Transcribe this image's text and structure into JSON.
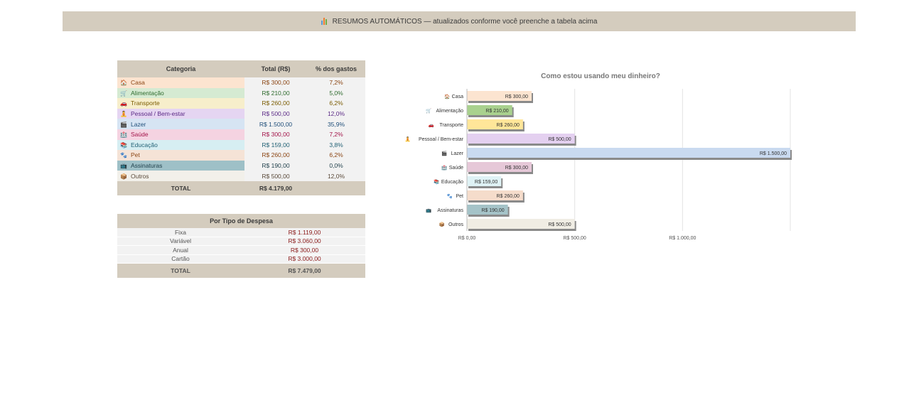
{
  "banner": {
    "icon": "bar-chart-icon",
    "text": "RESUMOS AUTOMÁTICOS — atualizados conforme você preenche a tabela acima"
  },
  "category_table": {
    "headers": [
      "Categoria",
      "Total (R$)",
      "% dos gastos"
    ],
    "rows": [
      {
        "icon": "house-icon",
        "glyph": "🏠",
        "name": "Casa",
        "total": "R$ 300,00",
        "pct": "7,2%",
        "bg": "#fce4d0",
        "color": "#8b4513"
      },
      {
        "icon": "shopping-cart-icon",
        "glyph": "🛒",
        "name": "Alimentação",
        "total": "R$ 210,00",
        "pct": "5,0%",
        "bg": "#d5ead2",
        "color": "#2e6b2e"
      },
      {
        "icon": "car-icon",
        "glyph": "🚗",
        "name": "Transporte",
        "total": "R$ 260,00",
        "pct": "6,2%",
        "bg": "#f7eecb",
        "color": "#7a5b00"
      },
      {
        "icon": "person-icon",
        "glyph": "🧘",
        "name": "Pessoal / Bem-estar",
        "total": "R$ 500,00",
        "pct": "12,0%",
        "bg": "#e5d5f2",
        "color": "#5b2a86"
      },
      {
        "icon": "film-icon",
        "glyph": "🎬",
        "name": "Lazer",
        "total": "R$ 1.500,00",
        "pct": "35,9%",
        "bg": "#d6e4f3",
        "color": "#1f4e79"
      },
      {
        "icon": "hospital-icon",
        "glyph": "🏥",
        "name": "Saúde",
        "total": "R$ 300,00",
        "pct": "7,2%",
        "bg": "#f5d3e1",
        "color": "#a3154a"
      },
      {
        "icon": "books-icon",
        "glyph": "📚",
        "name": "Educação",
        "total": "R$ 159,00",
        "pct": "3,8%",
        "bg": "#d6eef2",
        "color": "#1f5f73"
      },
      {
        "icon": "paw-icon",
        "glyph": "🐾",
        "name": "Pet",
        "total": "R$ 260,00",
        "pct": "6,2%",
        "bg": "#f5e3d6",
        "color": "#8b4513"
      },
      {
        "icon": "subscription-icon",
        "glyph": "📺",
        "name": "Assinaturas",
        "total": "R$ 190,00",
        "pct": "0,0%",
        "bg": "#9ec0c7",
        "color": "#1f3f4a"
      },
      {
        "icon": "box-icon",
        "glyph": "📦",
        "name": "Outros",
        "total": "R$ 500,00",
        "pct": "12,0%",
        "bg": "#f2f0ea",
        "color": "#5a4a3a"
      }
    ],
    "total_label": "TOTAL",
    "total_value": "R$ 4.179,00"
  },
  "type_table": {
    "header": "Por Tipo de Despesa",
    "rows": [
      {
        "name": "Fixa",
        "value": "R$ 1.119,00"
      },
      {
        "name": "Variável",
        "value": "R$ 3.060,00"
      },
      {
        "name": "Anual",
        "value": "R$ 300,00"
      },
      {
        "name": "Cartão",
        "value": "R$ 3.000,00"
      }
    ],
    "total_label": "TOTAL",
    "total_value": "R$ 7.479,00"
  },
  "chart_data": {
    "type": "bar",
    "orientation": "horizontal",
    "title": "Como estou usando meu dinheiro?",
    "categories": [
      "Casa",
      "Alimentação",
      "Transporte",
      "Pessoal / Bem-estar",
      "Lazer",
      "Saúde",
      "Educação",
      "Pet",
      "Assinaturas",
      "Outros"
    ],
    "values": [
      300,
      210,
      260,
      500,
      1500,
      300,
      159,
      260,
      190,
      500
    ],
    "value_labels": [
      "R$ 300,00",
      "R$ 210,00",
      "R$ 260,00",
      "R$ 500,00",
      "R$ 1.500,00",
      "R$ 300,00",
      "R$ 159,00",
      "R$ 260,00",
      "R$ 190,00",
      "R$ 500,00"
    ],
    "bar_colors": [
      "#fce4d0",
      "#a9d18e",
      "#ffe699",
      "#e4d0f0",
      "#c9daf0",
      "#e6c8d8",
      "#dff2f5",
      "#f5dccb",
      "#a5c3c8",
      "#f0ede4"
    ],
    "category_icons": [
      "house-icon",
      "shopping-cart-icon",
      "car-icon",
      "person-icon",
      "film-icon",
      "hospital-icon",
      "books-icon",
      "paw-icon",
      "subscription-icon",
      "box-icon"
    ],
    "xlim": [
      0,
      1500
    ],
    "xticks": [
      0,
      500,
      1000,
      1500
    ],
    "xtick_labels": [
      "R$ 0,00",
      "R$ 500,00",
      "R$ 1.000,00",
      ""
    ],
    "grid": true,
    "legend": "none"
  }
}
